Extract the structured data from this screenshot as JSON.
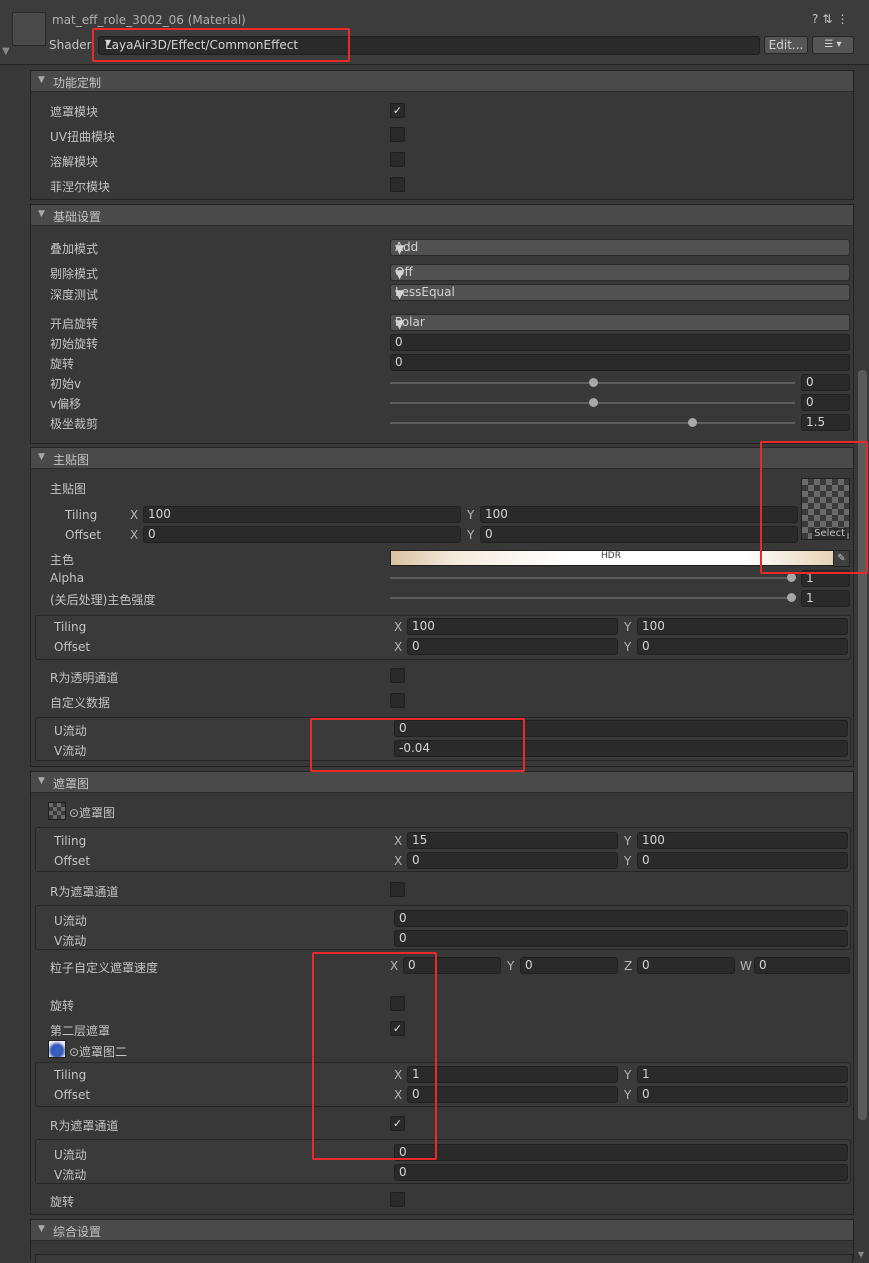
{
  "header": {
    "title": "mat_eff_role_3002_06 (Material)",
    "shader_label": "Shader",
    "shader_value": "LayaAir3D/Effect/CommonEffect",
    "edit_label": "Edit...",
    "icons": [
      "help-icon",
      "preset-icon",
      "more-icon"
    ]
  },
  "sections": {
    "func": {
      "title": "功能定制",
      "items": [
        {
          "label": "遮罩模块",
          "checked": true
        },
        {
          "label": "UV扭曲模块",
          "checked": false
        },
        {
          "label": "溶解模块",
          "checked": false
        },
        {
          "label": "菲涅尔模块",
          "checked": false
        }
      ]
    },
    "basic": {
      "title": "基础设置",
      "blend_label": "叠加模式",
      "blend_value": "Add",
      "cull_label": "剔除模式",
      "cull_value": "Off",
      "depth_label": "深度测试",
      "depth_value": "LessEqual",
      "rotate_on_label": "开启旋转",
      "rotate_on_value": "Polar",
      "init_rot_label": "初始旋转",
      "init_rot_value": "0",
      "rot_label": "旋转",
      "rot_value": "0",
      "init_v_label": "初始v",
      "init_v_value": "0",
      "v_offset_label": "v偏移",
      "v_offset_value": "0",
      "polar_label": "极坐裁剪",
      "polar_value": "1.5"
    },
    "main": {
      "title": "主贴图",
      "tex_label": "主贴图",
      "tiling_label": "Tiling",
      "offset_label": "Offset",
      "tiling_x": "100",
      "tiling_y": "100",
      "offset_x": "0",
      "offset_y": "0",
      "select_label": "Select",
      "color_label": "主色",
      "hdr_label": "HDR",
      "alpha_label": "Alpha",
      "alpha_value": "1",
      "intensity_label": "(关后处理)主色强度",
      "intensity_value": "1",
      "t2_tiling_x": "100",
      "t2_tiling_y": "100",
      "t2_offset_x": "0",
      "t2_offset_y": "0",
      "r_alpha_label": "R为透明通道",
      "custom_label": "自定义数据",
      "u_flow_label": "U流动",
      "u_flow_value": "0",
      "v_flow_label": "V流动",
      "v_flow_value": "-0.04"
    },
    "mask": {
      "title": "遮罩图",
      "tex_label": "⊙遮罩图",
      "tiling_x": "15",
      "tiling_y": "100",
      "offset_x": "0",
      "offset_y": "0",
      "r_mask_label": "R为遮罩通道",
      "u_flow_value": "0",
      "v_flow_value": "0",
      "particle_label": "粒子自定义遮罩速度",
      "px": "0",
      "py": "0",
      "pz": "0",
      "pw": "0",
      "rotate_label": "旋转",
      "second_label": "第二层遮罩",
      "tex2_label": "⊙遮罩图二",
      "t2_tiling_x": "1",
      "t2_tiling_y": "1",
      "t2_offset_x": "0",
      "t2_offset_y": "0",
      "r_mask2_label": "R为遮罩通道",
      "u2_value": "0",
      "v2_value": "0",
      "rotate2_label": "旋转"
    },
    "general": {
      "title": "综合设置"
    }
  },
  "axes": {
    "x": "X",
    "y": "Y",
    "z": "Z",
    "w": "W"
  },
  "colors": {
    "highlight": "#e82a2a",
    "panel": "#383838",
    "field": "#2a2a2a"
  }
}
